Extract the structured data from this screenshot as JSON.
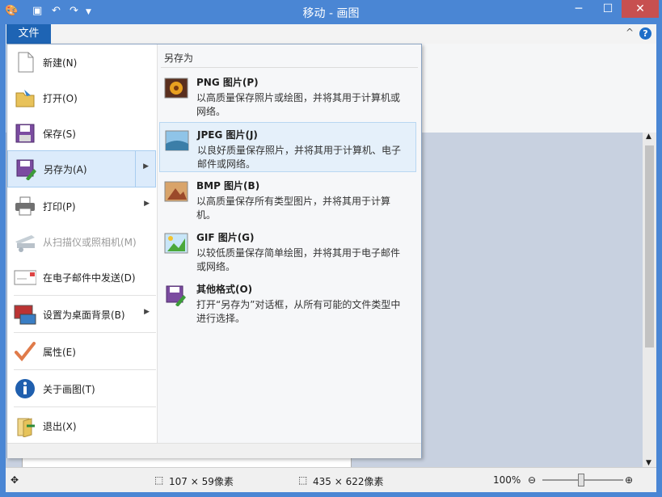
{
  "window": {
    "title": "移动 - 画图",
    "minimize_glyph": "─",
    "maximize_glyph": "☐",
    "close_glyph": "✕"
  },
  "ribbon": {
    "help_glyph": "?",
    "collapse_glyph": "^"
  },
  "file_tab": {
    "label": "文件"
  },
  "file_menu": {
    "items": [
      {
        "label": "新建(N)",
        "icon": "new-document-icon"
      },
      {
        "label": "打开(O)",
        "icon": "open-folder-icon"
      },
      {
        "label": "保存(S)",
        "icon": "save-disk-icon"
      },
      {
        "label": "另存为(A)",
        "icon": "save-as-icon",
        "has_submenu": true
      },
      {
        "label": "打印(P)",
        "icon": "printer-icon",
        "has_submenu": true
      },
      {
        "label": "从扫描仪或照相机(M)",
        "icon": "scanner-icon",
        "disabled": true
      },
      {
        "label": "在电子邮件中发送(D)",
        "icon": "email-icon"
      },
      {
        "label": "设置为桌面背景(B)",
        "icon": "desktop-background-icon",
        "has_submenu": true
      },
      {
        "label": "属性(E)",
        "icon": "properties-checkmark-icon"
      },
      {
        "label": "关于画图(T)",
        "icon": "info-icon"
      },
      {
        "label": "退出(X)",
        "icon": "exit-icon"
      }
    ],
    "submenu_arrow": "▶"
  },
  "save_as_panel": {
    "heading": "另存为",
    "options": [
      {
        "title": "PNG 图片(P)",
        "desc": "以高质量保存照片或绘图，并将其用于计算机或网络。",
        "icon": "png-image-icon"
      },
      {
        "title": "JPEG 图片(J)",
        "desc": "以良好质量保存照片，并将其用于计算机、电子邮件或网络。",
        "icon": "jpeg-image-icon",
        "selected": true
      },
      {
        "title": "BMP 图片(B)",
        "desc": "以高质量保存所有类型图片，并将其用于计算机。",
        "icon": "bmp-image-icon"
      },
      {
        "title": "GIF 图片(G)",
        "desc": "以较低质量保存简单绘图，并将其用于电子邮件或网络。",
        "icon": "gif-image-icon"
      },
      {
        "title": "其他格式(O)",
        "desc": "打开“另存为”对话框，从所有可能的文件类型中进行选择。",
        "icon": "other-formats-icon"
      }
    ]
  },
  "status_bar": {
    "selection_size": "107 × 59像素",
    "image_size": "435 × 622像素",
    "zoom": "100%"
  },
  "colors": {
    "titlebar": "#4a86d4",
    "file_tab": "#1e64b4",
    "selected_item": "#dcebfb",
    "close_button": "#c75050"
  }
}
